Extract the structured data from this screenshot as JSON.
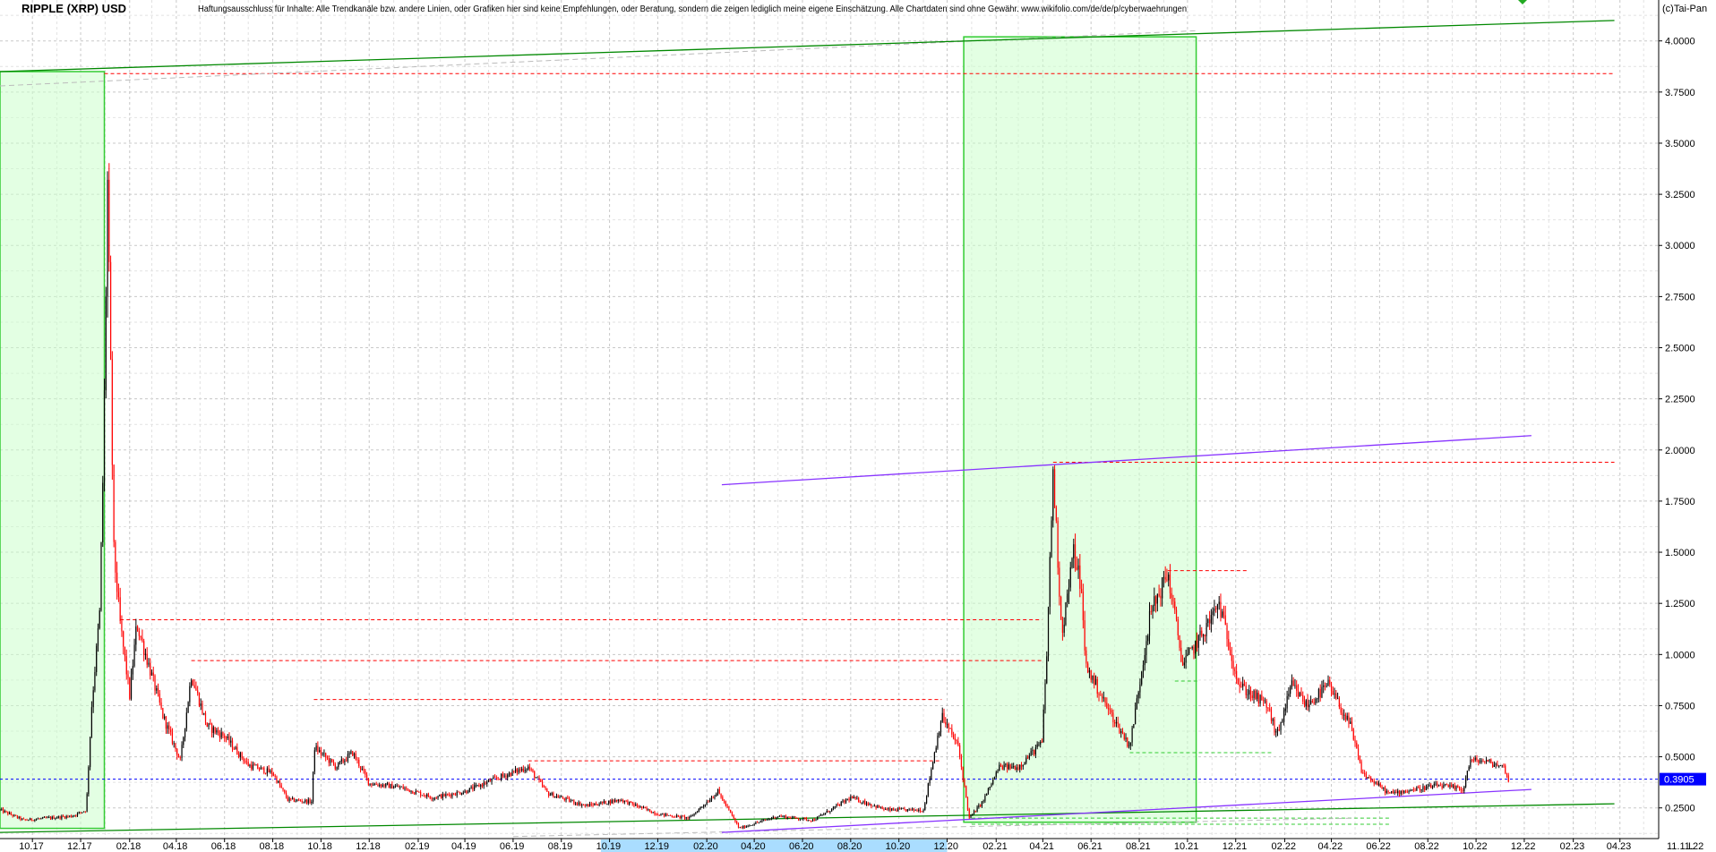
{
  "header": {
    "title": "RIPPLE (XRP) USD",
    "disclaimer": "Haftungsausschluss für Inhalte: Alle Trendkanäle bzw. andere Linien, oder Grafiken hier sind keine Empfehlungen, oder Beratung, sondern die zeigen lediglich meine eigene Einschätzung. Alle Chartdaten sind ohne Gewähr.  www.wikifolio.com/de/de/p/cyberwaehrungen",
    "copyright": "(c)Tai-Pan",
    "date_label": "11.11.22",
    "scale_marker": "L"
  },
  "colors": {
    "up_candle": "#000000",
    "down_candle": "#ff0000",
    "highlight_fill": "#ccffcc",
    "highlight_border": "#33cc33",
    "channel_green": "#008800",
    "channel_purple": "#8833ff",
    "resistance_red": "#ff0000",
    "support_green": "#33cc33",
    "current_price_blue": "#0000ff",
    "price_tag_bg": "#0000ff",
    "grid": "#c8c8c8",
    "axis_band": "#aaddff"
  },
  "chart_data": {
    "type": "candlestick",
    "title": "RIPPLE (XRP) USD",
    "xlabel": "",
    "ylabel": "",
    "ylim": [
      0.1,
      4.2
    ],
    "xlim": [
      "2017-08-21",
      "2023-05-20"
    ],
    "grid": true,
    "y_scale": "linear",
    "yticks": [
      "0.2500",
      "0.5000",
      "0.7500",
      "1.0000",
      "1.2500",
      "1.5000",
      "1.7500",
      "2.0000",
      "2.2500",
      "2.5000",
      "2.7500",
      "3.0000",
      "3.2500",
      "3.5000",
      "3.7500",
      "4.0000"
    ],
    "xticks": [
      "10.17",
      "12.17",
      "02.18",
      "04.18",
      "06.18",
      "08.18",
      "10.18",
      "12.18",
      "02.19",
      "04.19",
      "06.19",
      "08.19",
      "10.19",
      "12.19",
      "02.20",
      "04.20",
      "06.20",
      "08.20",
      "10.20",
      "12.20",
      "02.21",
      "04.21",
      "06.21",
      "08.21",
      "10.21",
      "12.21",
      "02.22",
      "04.22",
      "06.22",
      "08.22",
      "10.22",
      "12.22",
      "02.23",
      "04.23"
    ],
    "current_price": "0.3905",
    "price_path": [
      [
        "2017-08-21",
        0.24
      ],
      [
        "2017-09-20",
        0.19
      ],
      [
        "2017-10-20",
        0.2
      ],
      [
        "2017-11-20",
        0.21
      ],
      [
        "2017-12-08",
        0.24
      ],
      [
        "2017-12-15",
        0.75
      ],
      [
        "2017-12-25",
        1.2
      ],
      [
        "2017-12-30",
        2.0
      ],
      [
        "2018-01-04",
        3.3
      ],
      [
        "2018-01-07",
        2.6
      ],
      [
        "2018-01-12",
        1.5
      ],
      [
        "2018-01-20",
        1.15
      ],
      [
        "2018-02-01",
        0.8
      ],
      [
        "2018-02-10",
        1.15
      ],
      [
        "2018-02-25",
        0.95
      ],
      [
        "2018-03-15",
        0.7
      ],
      [
        "2018-04-06",
        0.48
      ],
      [
        "2018-04-20",
        0.9
      ],
      [
        "2018-05-10",
        0.65
      ],
      [
        "2018-06-01",
        0.6
      ],
      [
        "2018-07-01",
        0.46
      ],
      [
        "2018-08-01",
        0.42
      ],
      [
        "2018-08-20",
        0.29
      ],
      [
        "2018-09-20",
        0.28
      ],
      [
        "2018-09-22",
        0.55
      ],
      [
        "2018-10-20",
        0.45
      ],
      [
        "2018-11-10",
        0.52
      ],
      [
        "2018-12-01",
        0.37
      ],
      [
        "2019-01-10",
        0.35
      ],
      [
        "2019-02-20",
        0.3
      ],
      [
        "2019-04-01",
        0.33
      ],
      [
        "2019-05-15",
        0.4
      ],
      [
        "2019-06-20",
        0.45
      ],
      [
        "2019-07-15",
        0.32
      ],
      [
        "2019-09-01",
        0.26
      ],
      [
        "2019-10-15",
        0.29
      ],
      [
        "2019-12-01",
        0.22
      ],
      [
        "2020-01-10",
        0.2
      ],
      [
        "2020-02-15",
        0.33
      ],
      [
        "2020-03-13",
        0.15
      ],
      [
        "2020-05-01",
        0.21
      ],
      [
        "2020-06-15",
        0.19
      ],
      [
        "2020-08-01",
        0.3
      ],
      [
        "2020-09-15",
        0.24
      ],
      [
        "2020-11-01",
        0.24
      ],
      [
        "2020-11-24",
        0.7
      ],
      [
        "2020-12-15",
        0.55
      ],
      [
        "2020-12-29",
        0.2
      ],
      [
        "2021-01-15",
        0.28
      ],
      [
        "2021-02-05",
        0.45
      ],
      [
        "2021-03-01",
        0.45
      ],
      [
        "2021-03-31",
        0.57
      ],
      [
        "2021-04-06",
        1.0
      ],
      [
        "2021-04-14",
        1.9
      ],
      [
        "2021-04-25",
        1.1
      ],
      [
        "2021-05-10",
        1.5
      ],
      [
        "2021-05-19",
        1.35
      ],
      [
        "2021-05-25",
        0.95
      ],
      [
        "2021-06-20",
        0.75
      ],
      [
        "2021-07-20",
        0.55
      ],
      [
        "2021-08-15",
        1.2
      ],
      [
        "2021-09-06",
        1.4
      ],
      [
        "2021-09-25",
        0.95
      ],
      [
        "2021-10-20",
        1.1
      ],
      [
        "2021-11-10",
        1.25
      ],
      [
        "2021-12-05",
        0.85
      ],
      [
        "2022-01-10",
        0.75
      ],
      [
        "2022-01-22",
        0.6
      ],
      [
        "2022-02-10",
        0.85
      ],
      [
        "2022-03-01",
        0.75
      ],
      [
        "2022-03-28",
        0.85
      ],
      [
        "2022-04-25",
        0.65
      ],
      [
        "2022-05-10",
        0.42
      ],
      [
        "2022-06-13",
        0.32
      ],
      [
        "2022-07-15",
        0.34
      ],
      [
        "2022-08-15",
        0.36
      ],
      [
        "2022-09-15",
        0.34
      ],
      [
        "2022-09-23",
        0.48
      ],
      [
        "2022-10-10",
        0.48
      ],
      [
        "2022-11-05",
        0.45
      ],
      [
        "2022-11-11",
        0.39
      ]
    ],
    "highlight_zones": [
      {
        "from": "2017-08-21",
        "to": "2017-12-31",
        "low": 0.15,
        "high": 3.85
      },
      {
        "from": "2020-12-22",
        "to": "2021-10-12",
        "low": 0.18,
        "high": 4.02
      }
    ],
    "trend_lines": [
      {
        "style": "green-channel",
        "from": [
          "2017-08-21",
          3.85
        ],
        "to": [
          "2023-03-25",
          4.1
        ]
      },
      {
        "style": "green-channel",
        "from": [
          "2017-08-21",
          0.13
        ],
        "to": [
          "2023-03-25",
          0.27
        ]
      },
      {
        "style": "purple-channel",
        "from": [
          "2020-02-20",
          1.83
        ],
        "to": [
          "2022-12-10",
          2.07
        ]
      },
      {
        "style": "purple-channel",
        "from": [
          "2020-02-20",
          0.13
        ],
        "to": [
          "2022-12-10",
          0.34
        ]
      }
    ],
    "resistance_levels": [
      {
        "value": 3.84,
        "from": "2017-12-31",
        "to": "2023-03-25"
      },
      {
        "value": 1.94,
        "from": "2021-04-14",
        "to": "2023-03-25"
      },
      {
        "value": 1.41,
        "from": "2021-09-06",
        "to": "2021-12-15"
      },
      {
        "value": 1.17,
        "from": "2018-01-20",
        "to": "2021-03-31"
      },
      {
        "value": 0.97,
        "from": "2018-04-20",
        "to": "2021-03-31"
      },
      {
        "value": 0.78,
        "from": "2018-09-22",
        "to": "2020-11-24"
      },
      {
        "value": 0.48,
        "from": "2019-06-20",
        "to": "2020-11-24"
      }
    ],
    "support_levels": [
      {
        "value": 0.87,
        "from": "2021-09-15",
        "to": "2021-10-15"
      },
      {
        "value": 0.52,
        "from": "2021-07-20",
        "to": "2022-01-15"
      },
      {
        "value": 0.2,
        "from": "2021-01-01",
        "to": "2022-06-15"
      },
      {
        "value": 0.17,
        "from": "2021-01-01",
        "to": "2022-06-15"
      }
    ]
  }
}
